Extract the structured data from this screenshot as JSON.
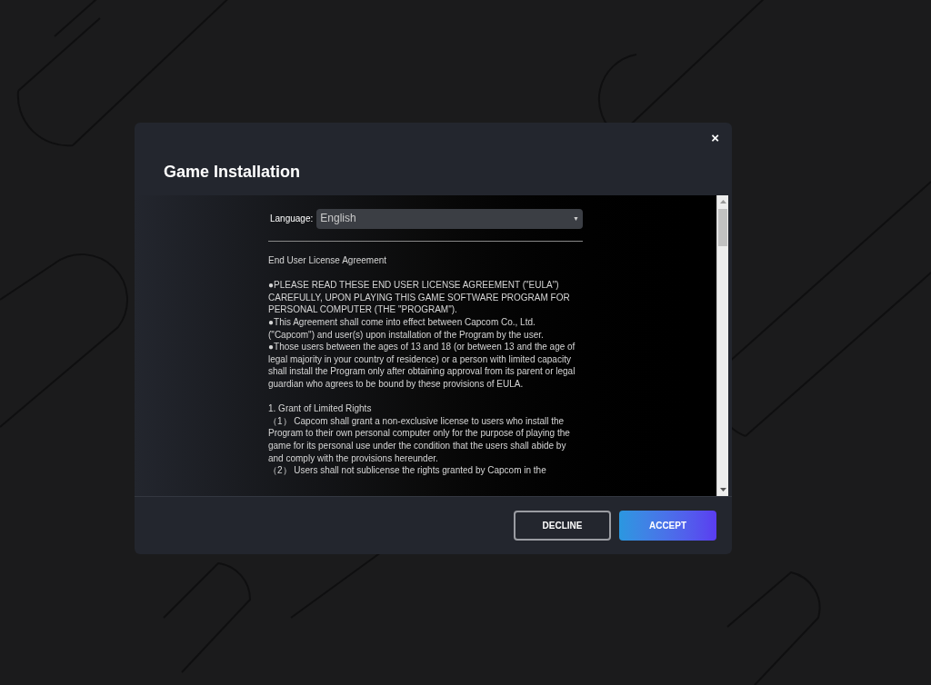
{
  "dialog": {
    "title": "Game Installation",
    "close": "×"
  },
  "language": {
    "label": "Language:",
    "value": "English",
    "arrow": "▼"
  },
  "eula_sections": [
    [
      "End User License Agreement"
    ],
    [
      "●PLEASE READ THESE END USER LICENSE AGREEMENT (\"EULA\") CAREFULLY, UPON PLAYING THIS GAME SOFTWARE PROGRAM FOR PERSONAL COMPUTER (THE \"PROGRAM\").",
      "●This Agreement shall come into effect between Capcom Co., Ltd. (\"Capcom\") and user(s) upon installation of the Program by the user.",
      "●Those users between the ages of 13 and 18 (or between 13 and the age of legal majority in your country of residence) or a person with limited capacity shall install the Program only after obtaining approval from its parent or legal guardian who agrees to be bound by these provisions of EULA."
    ],
    [
      "1. Grant of Limited Rights",
      "（1） Capcom shall grant a non-exclusive license to users who install the Program to their own personal computer only for the purpose of playing the game for its personal use under the condition that the users shall abide by and comply with the provisions hereunder.",
      "（2） Users shall not sublicense the rights granted by Capcom in the"
    ]
  ],
  "buttons": [
    {
      "label": "DECLINE",
      "kind": "outline"
    },
    {
      "label": "ACCEPT",
      "kind": "primary"
    }
  ]
}
